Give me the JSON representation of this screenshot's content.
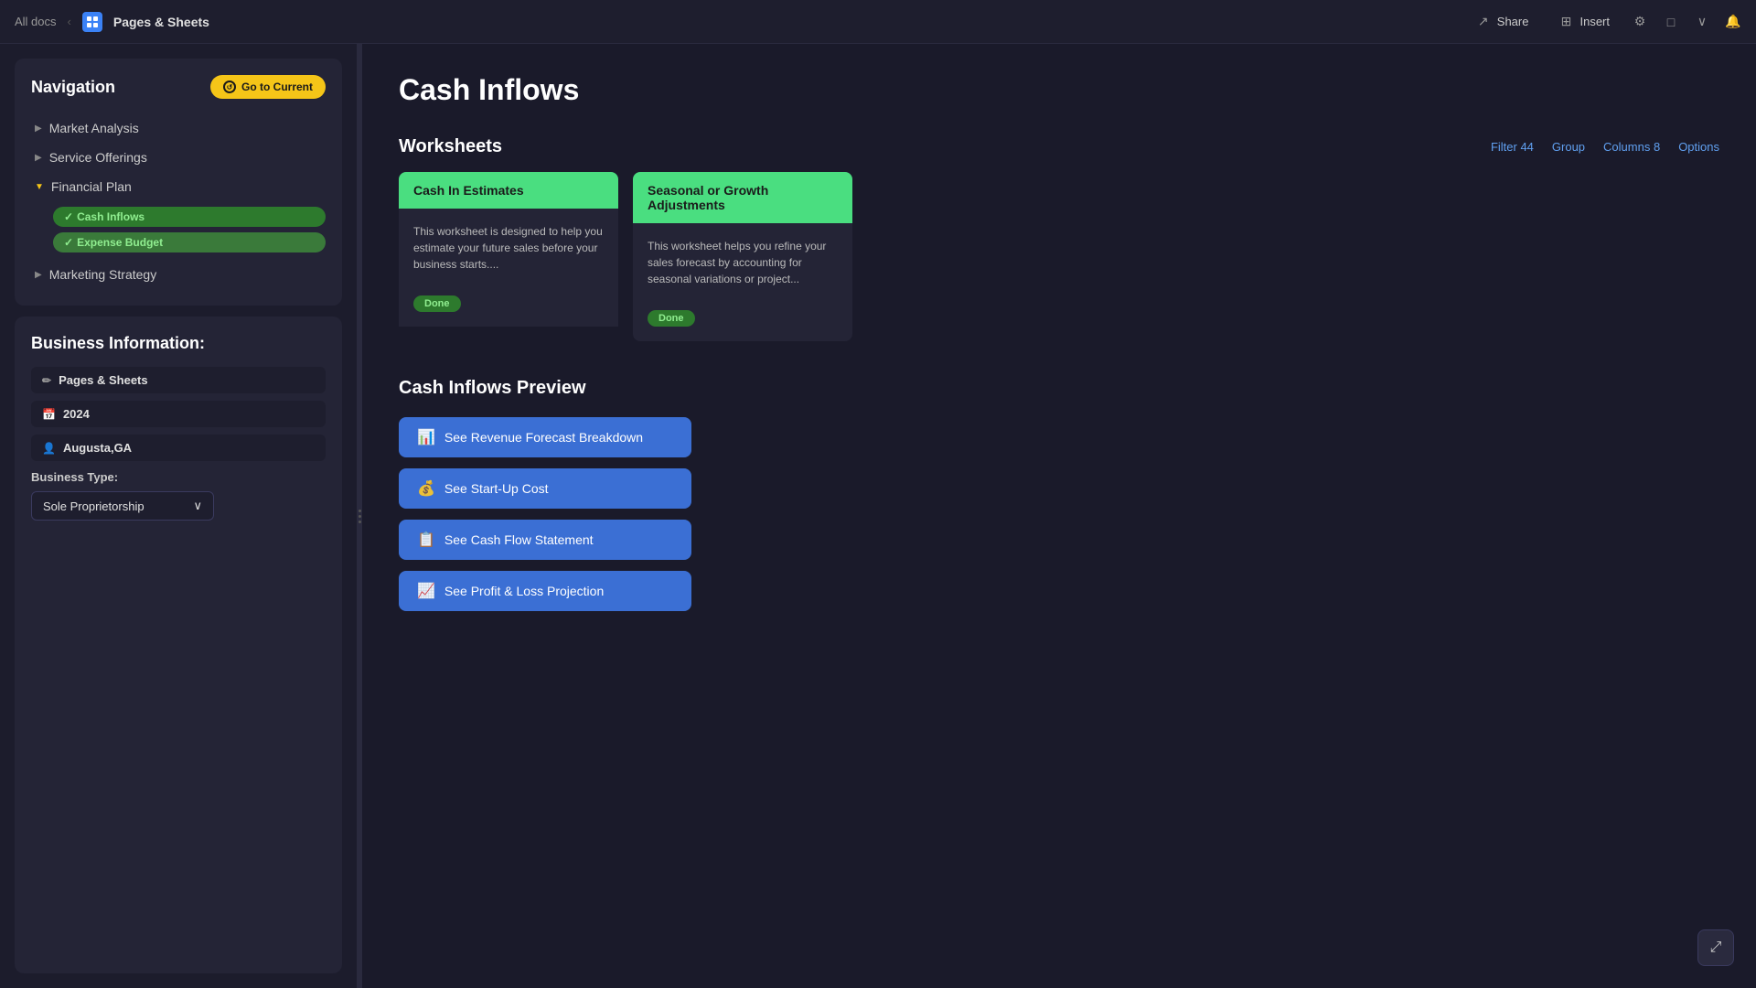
{
  "topbar": {
    "all_docs_label": "All docs",
    "app_name": "Pages & Sheets",
    "share_label": "Share",
    "insert_label": "Insert"
  },
  "sidebar": {
    "navigation": {
      "title": "Navigation",
      "go_to_current_label": "Go to Current",
      "items": [
        {
          "id": "market-analysis",
          "label": "Market Analysis",
          "expanded": false
        },
        {
          "id": "service-offerings",
          "label": "Service Offerings",
          "expanded": false
        },
        {
          "id": "financial-plan",
          "label": "Financial Plan",
          "expanded": true,
          "children": [
            {
              "id": "cash-inflows",
              "label": "Cash Inflows",
              "active": true
            },
            {
              "id": "expense-budget",
              "label": "Expense Budget"
            }
          ]
        },
        {
          "id": "marketing-strategy",
          "label": "Marketing Strategy",
          "expanded": false
        }
      ]
    },
    "business": {
      "title": "Business Information:",
      "fields": [
        {
          "id": "name",
          "icon": "✏️",
          "value": "Pages & Sheets"
        },
        {
          "id": "year",
          "icon": "📅",
          "value": "2024"
        },
        {
          "id": "location",
          "icon": "👤",
          "value": "Augusta,GA"
        }
      ],
      "business_type_label": "Business Type:",
      "business_type_value": "Sole Proprietorship"
    }
  },
  "main": {
    "page_title": "Cash Inflows",
    "worksheets": {
      "section_title": "Worksheets",
      "filter_label": "Filter 44",
      "group_label": "Group",
      "columns_label": "Columns 8",
      "options_label": "Options",
      "cards": [
        {
          "id": "cash-in-estimates",
          "header": "Cash In Estimates",
          "description": "This worksheet is designed to help you estimate your future sales before your business starts....",
          "status": "Done"
        },
        {
          "id": "seasonal-growth",
          "header": "Seasonal or Growth Adjustments",
          "description": "This worksheet helps you refine your sales forecast by accounting for seasonal variations or project...",
          "status": "Done"
        }
      ]
    },
    "preview": {
      "section_title": "Cash Inflows Preview",
      "buttons": [
        {
          "id": "revenue-forecast",
          "icon": "📊",
          "label": "See Revenue Forecast Breakdown"
        },
        {
          "id": "startup-cost",
          "icon": "💰",
          "label": "See Start-Up Cost"
        },
        {
          "id": "cash-flow",
          "icon": "📋",
          "label": "See Cash Flow Statement"
        },
        {
          "id": "profit-loss",
          "icon": "📈",
          "label": "See Profit & Loss Projection"
        }
      ]
    }
  }
}
